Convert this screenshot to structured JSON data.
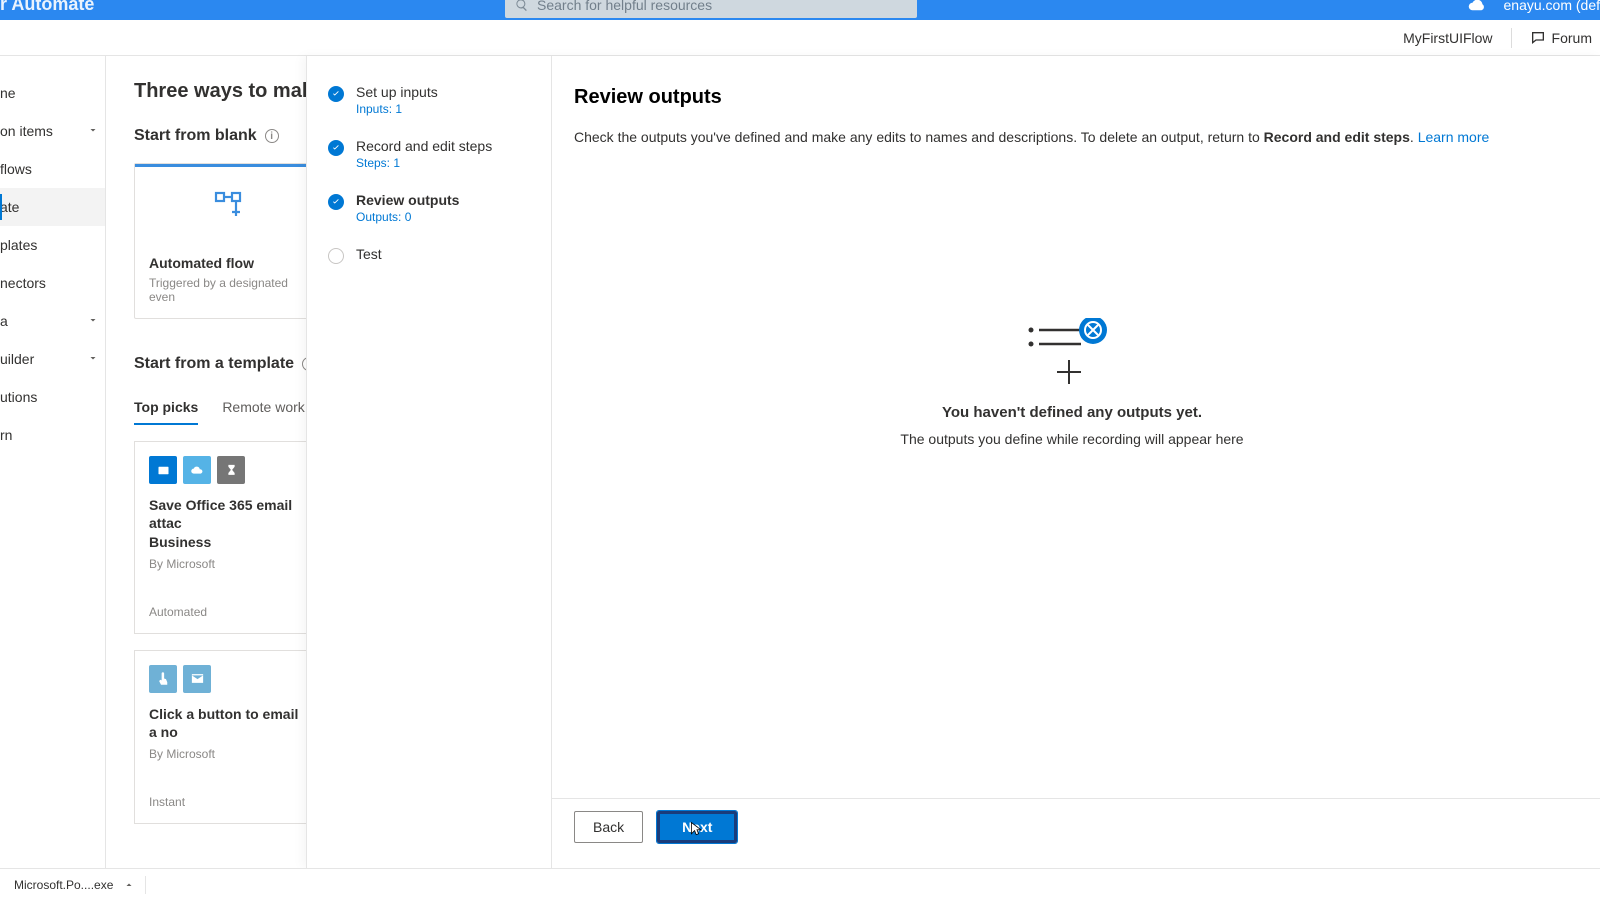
{
  "topbar": {
    "brand": "r Automate",
    "search_placeholder": "Search for helpful resources",
    "tenant": "enayu.com (def"
  },
  "secondary": {
    "flow_name": "MyFirstUIFlow",
    "forum": "Forum"
  },
  "nav": {
    "items": [
      {
        "label": "ne",
        "chevron": false,
        "active": false
      },
      {
        "label": "on items",
        "chevron": true,
        "active": false
      },
      {
        "label": "flows",
        "chevron": false,
        "active": false
      },
      {
        "label": "ate",
        "chevron": false,
        "active": true
      },
      {
        "label": "plates",
        "chevron": false,
        "active": false
      },
      {
        "label": "nectors",
        "chevron": false,
        "active": false
      },
      {
        "label": "a",
        "chevron": true,
        "active": false
      },
      {
        "label": "uilder",
        "chevron": true,
        "active": false
      },
      {
        "label": "utions",
        "chevron": false,
        "active": false
      },
      {
        "label": "rn",
        "chevron": false,
        "active": false
      }
    ]
  },
  "content": {
    "page_title": "Three ways to make a flo",
    "start_blank": "Start from blank",
    "automated_card": {
      "title": "Automated flow",
      "subtitle": "Triggered by a designated even"
    },
    "start_template": "Start from a template",
    "tabs": {
      "top_picks": "Top picks",
      "remote_work": "Remote work"
    },
    "templates": [
      {
        "title": "Save Office 365 email attac\nBusiness",
        "by": "By Microsoft",
        "type": "Automated"
      },
      {
        "title": "Click a button to email a no",
        "by": "By Microsoft",
        "type": "Instant"
      }
    ]
  },
  "wizard": {
    "steps": [
      {
        "label": "Set up inputs",
        "sub": "Inputs: 1",
        "state": "done"
      },
      {
        "label": "Record and edit steps",
        "sub": "Steps: 1",
        "state": "done"
      },
      {
        "label": "Review outputs",
        "sub": "Outputs: 0",
        "state": "current"
      },
      {
        "label": "Test",
        "sub": "",
        "state": "pending"
      }
    ],
    "review": {
      "heading": "Review outputs",
      "desc_pre": "Check the outputs you've defined and make any edits to names and descriptions. To delete an output, return to ",
      "desc_bold": "Record and edit steps",
      "desc_post": ". ",
      "learn_more": "Learn more"
    },
    "empty": {
      "title": "You haven't defined any outputs yet.",
      "sub": "The outputs you define while recording will appear here"
    },
    "buttons": {
      "back": "Back",
      "next": "Next"
    }
  },
  "bottombar": {
    "download": "Microsoft.Po....exe"
  }
}
